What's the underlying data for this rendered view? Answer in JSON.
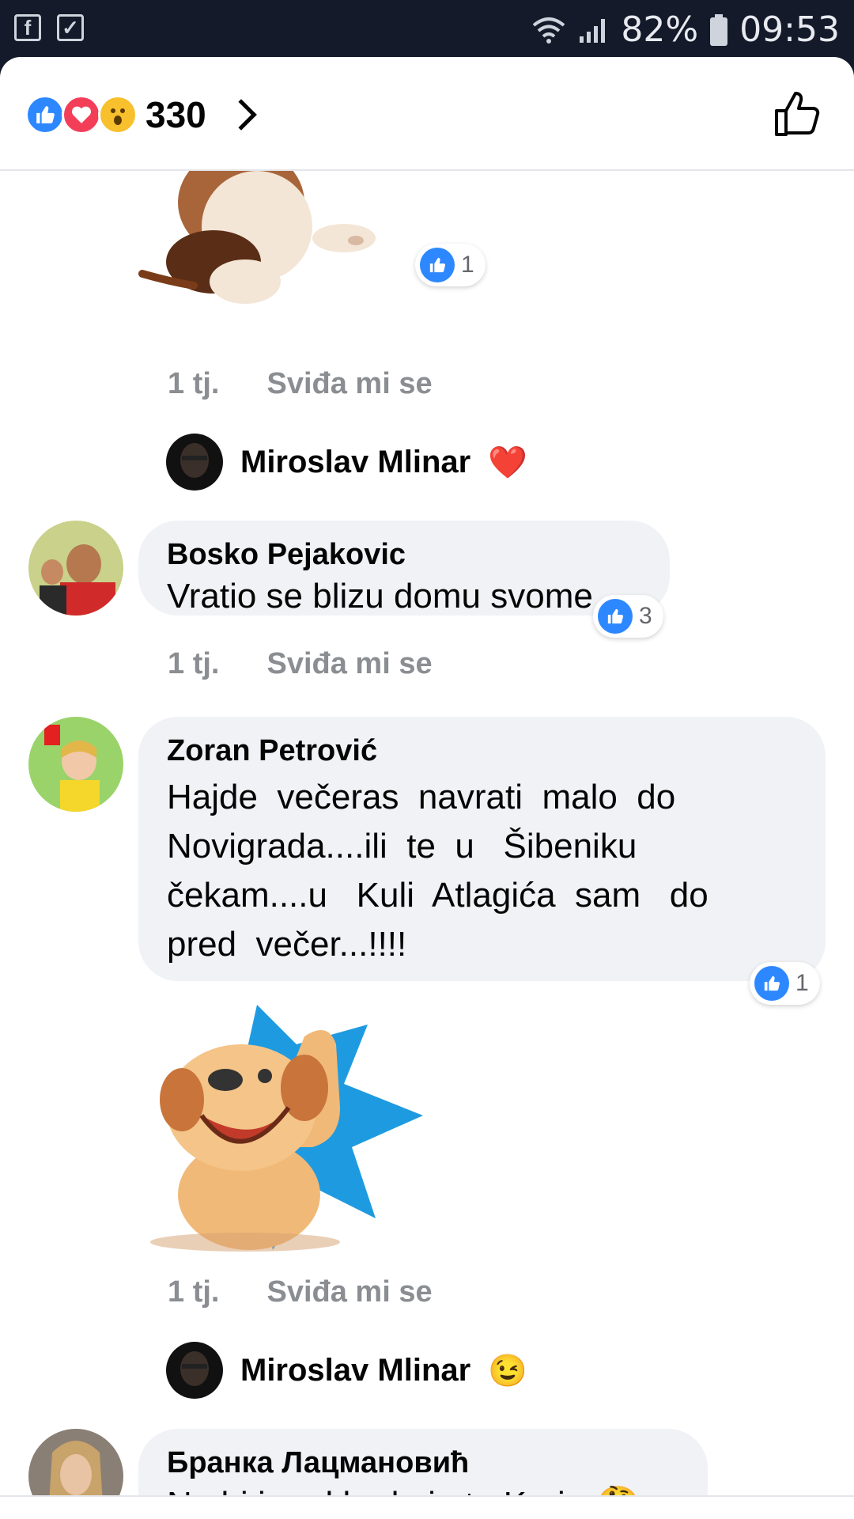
{
  "status_bar": {
    "left_icons": [
      "facebook-icon",
      "checklist-icon"
    ],
    "battery": "82%",
    "time": "09:53"
  },
  "reactions_header": {
    "types": [
      "like",
      "love",
      "wow"
    ],
    "count": "330"
  },
  "comments": [
    {
      "id": "sticker-comment-top",
      "reaction_count": "1",
      "time": "1 tj.",
      "like_label": "Sviđa mi se"
    },
    {
      "id": "reply-1",
      "name": "Miroslav Mlinar",
      "emoji": "❤️"
    },
    {
      "id": "bosko",
      "name": "Bosko Pejakovic",
      "text": "Vratio se blizu domu svome",
      "reaction_count": "3",
      "time": "1 tj.",
      "like_label": "Sviđa mi se"
    },
    {
      "id": "zoran",
      "name": "Zoran Petrović",
      "text_lines": [
        "Hajde  večeras  navrati  malo  do",
        "Novigrada....ili  te  u   Šibeniku",
        "čekam....u   Kuli  Atlagića  sam   do",
        "pred  večer...!!!!"
      ],
      "reaction_count": "1",
      "time": "1 tj.",
      "like_label": "Sviđa mi se"
    },
    {
      "id": "reply-2",
      "name": "Miroslav Mlinar",
      "emoji": "😉"
    },
    {
      "id": "branka",
      "name": "Бранка Лацмановић",
      "text": "Ne bi ja rekla da je to Karin",
      "emoji": "🤔"
    }
  ],
  "colors": {
    "accent": "#2d88ff",
    "love": "#f33e58",
    "bubble": "#f0f2f5",
    "meta_text": "#8a8d91"
  }
}
